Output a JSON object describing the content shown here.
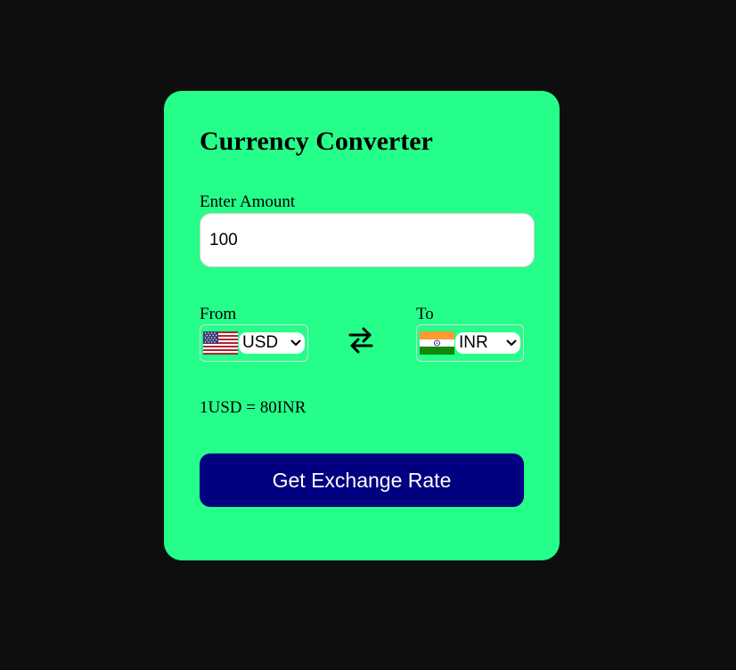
{
  "converter": {
    "title": "Currency Converter",
    "amount_label": "Enter Amount",
    "amount_value": "100",
    "from": {
      "label": "From",
      "currency": "USD",
      "flag": "us-flag-icon"
    },
    "to": {
      "label": "To",
      "currency": "INR",
      "flag": "india-flag-icon"
    },
    "swap_icon": "swap-arrows-icon",
    "rate_message": "1USD = 80INR",
    "button_label": "Get Exchange Rate"
  },
  "colors": {
    "page_background": "#0f0e0e",
    "card_background": "#25ff8a",
    "button_background": "#000080",
    "button_text": "#ffffff"
  }
}
